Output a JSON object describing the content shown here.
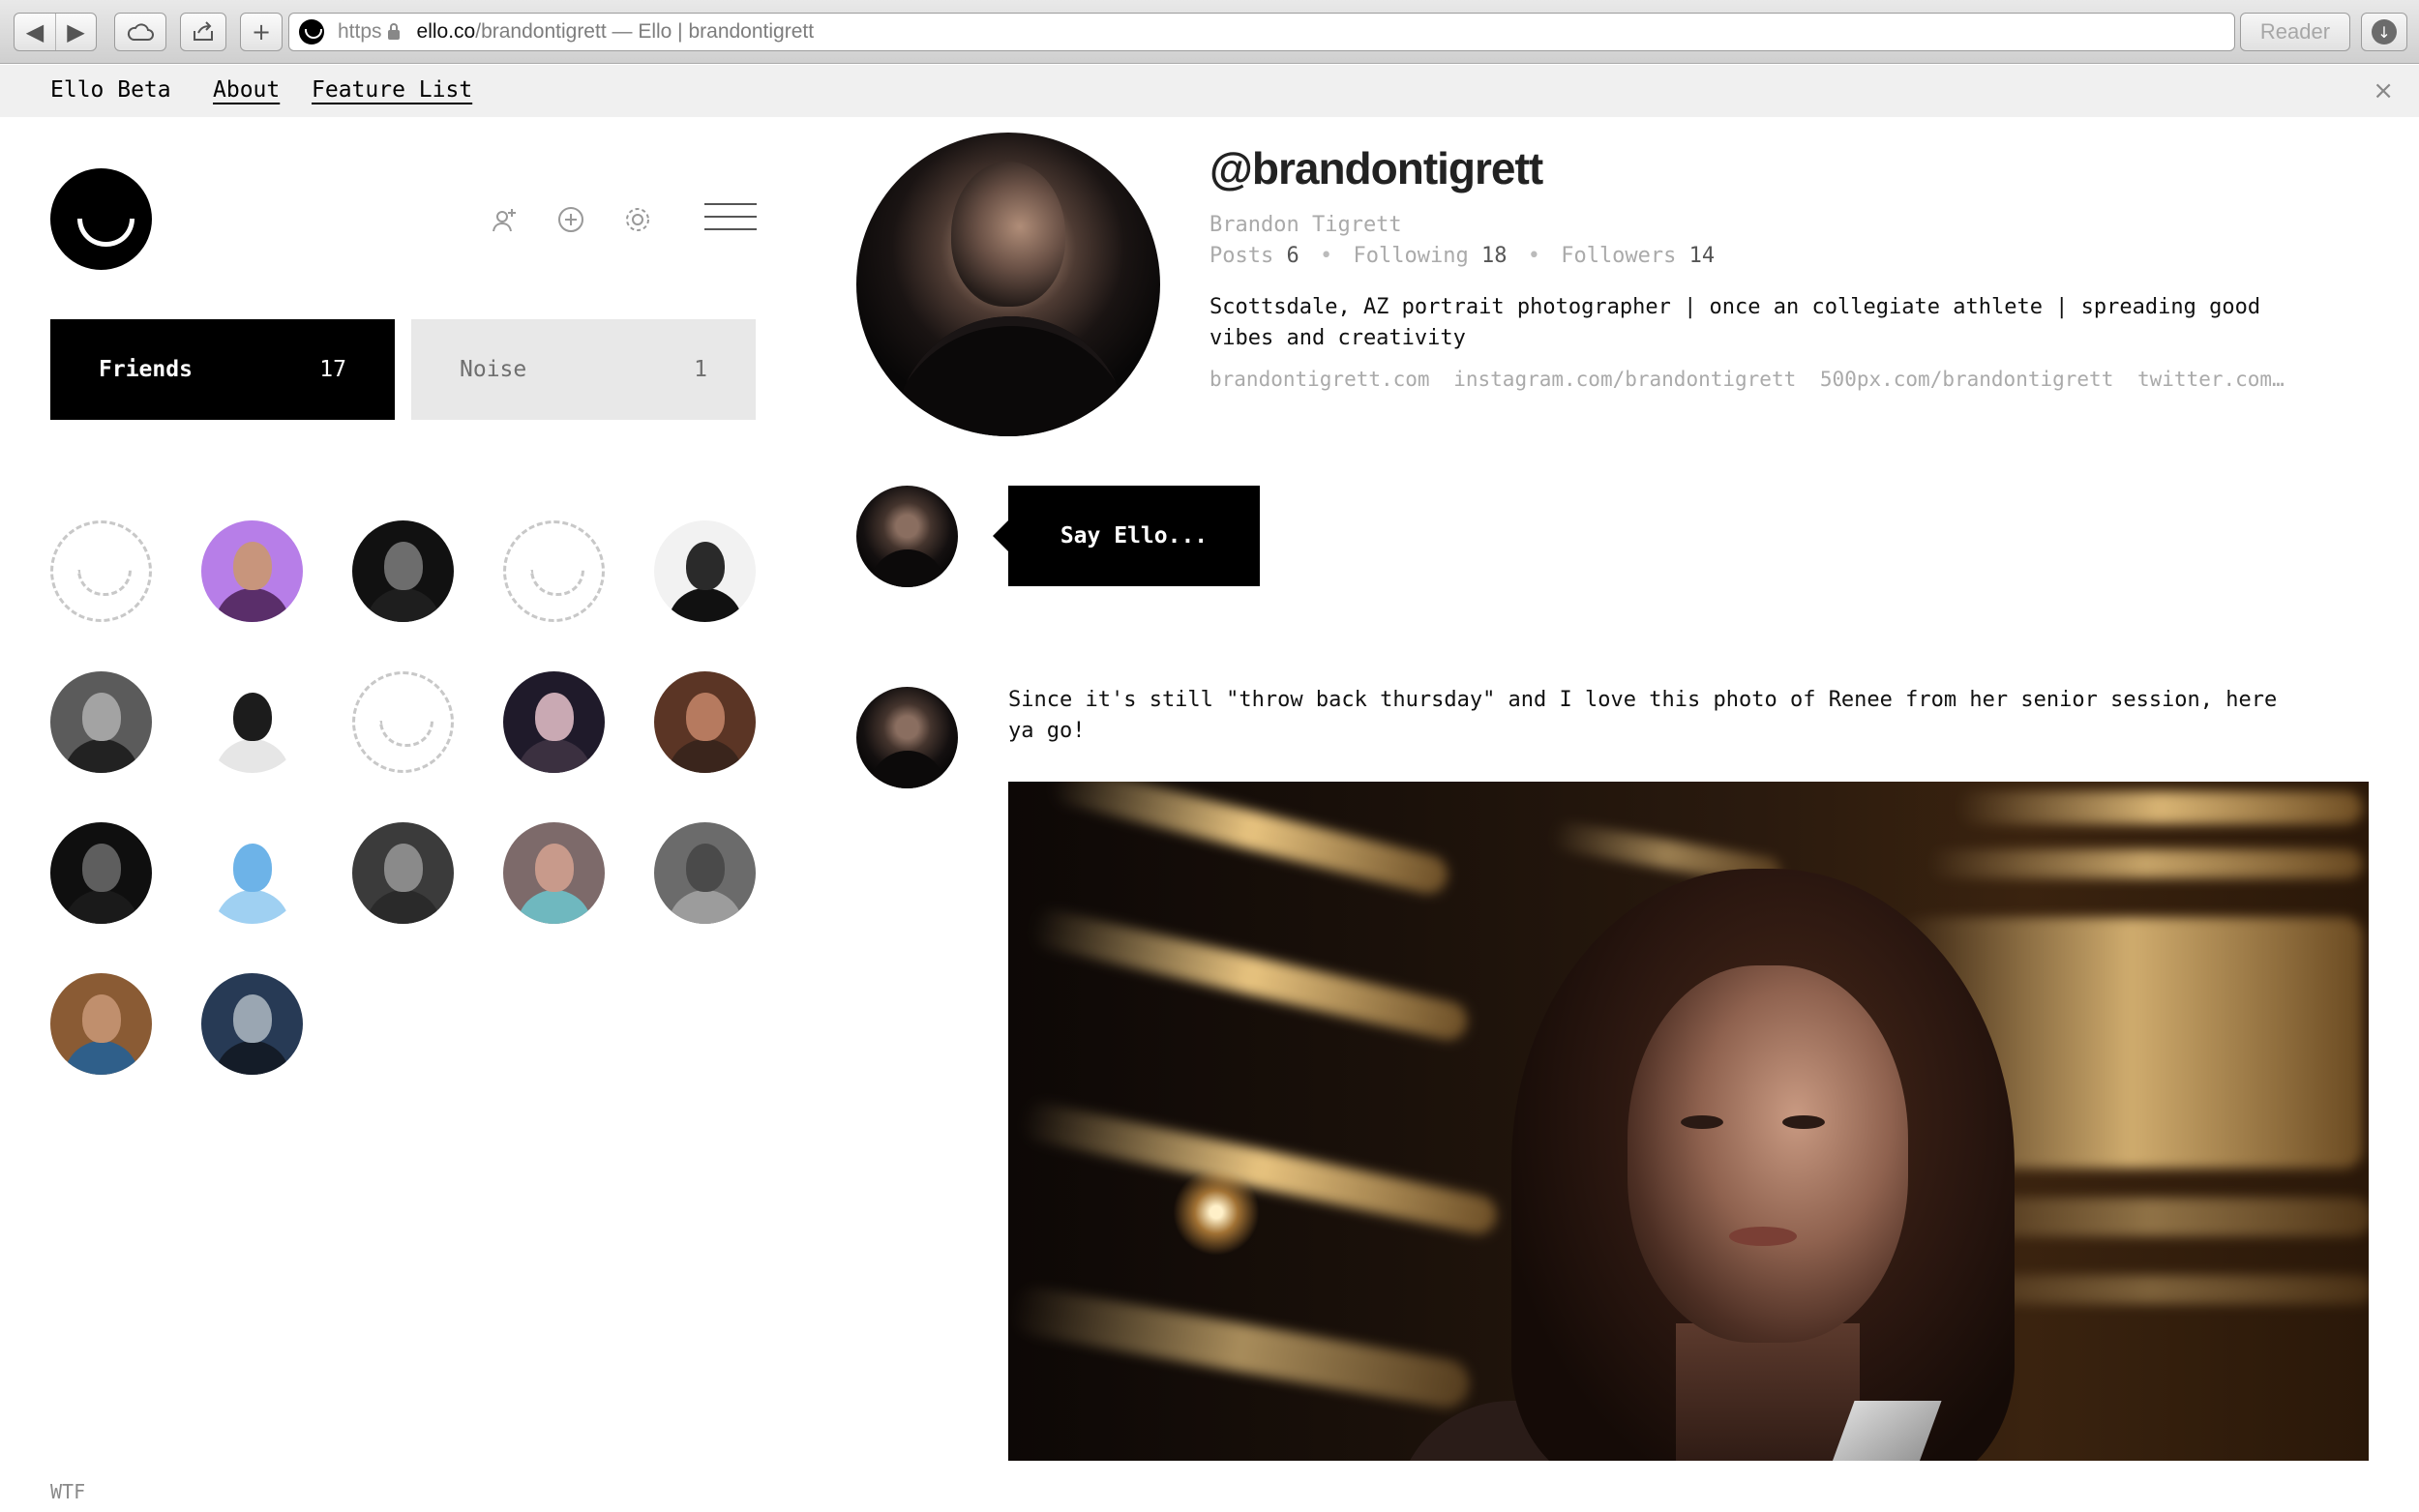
{
  "browser": {
    "url_scheme": "https",
    "url_host": "ello.co",
    "url_path_and_title": "/brandontigrett — Ello | brandontigrett",
    "reader_label": "Reader",
    "buttons": {
      "add_tab": "+"
    }
  },
  "beta_bar": {
    "brand": "Ello Beta",
    "links": [
      "About",
      "Feature List"
    ],
    "close": "×"
  },
  "sidebar": {
    "tabs": [
      {
        "label": "Friends",
        "count": "17",
        "active": true
      },
      {
        "label": "Noise",
        "count": "1",
        "active": false
      }
    ],
    "friends": [
      {
        "type": "placeholder"
      },
      {
        "type": "photo",
        "bg": "#b77ee8",
        "skin": "#c8957c",
        "shirt": "#5a2e6a"
      },
      {
        "type": "photo",
        "bg": "#111111",
        "skin": "#6d6d6d",
        "shirt": "#1e1e1e"
      },
      {
        "type": "placeholder"
      },
      {
        "type": "photo",
        "bg": "#f2f2f2",
        "skin": "#2a2a2a",
        "shirt": "#111111"
      },
      {
        "type": "photo",
        "bg": "#5b5b5b",
        "skin": "#a3a3a3",
        "shirt": "#222222"
      },
      {
        "type": "photo",
        "bg": "#ffffff",
        "skin": "#1c1c1c",
        "shirt": "#e6e6e6"
      },
      {
        "type": "placeholder"
      },
      {
        "type": "photo",
        "bg": "#1f1a2a",
        "skin": "#c9a9b3",
        "shirt": "#3b3040"
      },
      {
        "type": "photo",
        "bg": "#5b3525",
        "skin": "#b67a5f",
        "shirt": "#3a251c"
      },
      {
        "type": "photo",
        "bg": "#0f0f0f",
        "skin": "#5e5e5e",
        "shirt": "#1a1a1a"
      },
      {
        "type": "photo",
        "bg": "#ffffff",
        "skin": "#6db3e8",
        "shirt": "#9fd0f2"
      },
      {
        "type": "photo",
        "bg": "#3b3b3b",
        "skin": "#8a8a8a",
        "shirt": "#2a2a2a"
      },
      {
        "type": "photo",
        "bg": "#7d6a6a",
        "skin": "#c89a8b",
        "shirt": "#6fb8bf"
      },
      {
        "type": "photo",
        "bg": "#6b6b6b",
        "skin": "#4a4a4a",
        "shirt": "#9c9c9c"
      },
      {
        "type": "photo",
        "bg": "#8a5b34",
        "skin": "#c08f6d",
        "shirt": "#2f5f8a"
      },
      {
        "type": "photo",
        "bg": "#273a55",
        "skin": "#9aa6b2",
        "shirt": "#141c28"
      }
    ],
    "footer_link": "WTF"
  },
  "profile": {
    "username": "@brandontigrett",
    "real_name": "Brandon Tigrett",
    "posts_label": "Posts",
    "posts": "6",
    "following_label": "Following",
    "following": "18",
    "followers_label": "Followers",
    "followers": "14",
    "separator": "•",
    "bio": "Scottsdale, AZ portrait photographer | once an collegiate athlete | spreading good vibes and creativity",
    "links": [
      "brandontigrett.com",
      "instagram.com/brandontigrett",
      "500px.com/brandontigrett",
      "twitter.com…"
    ]
  },
  "composer": {
    "prompt": "Say Ello..."
  },
  "post": {
    "text": "Since it's still \"throw back thursday\" and I love this photo of Renee from her senior session, here ya go!"
  }
}
